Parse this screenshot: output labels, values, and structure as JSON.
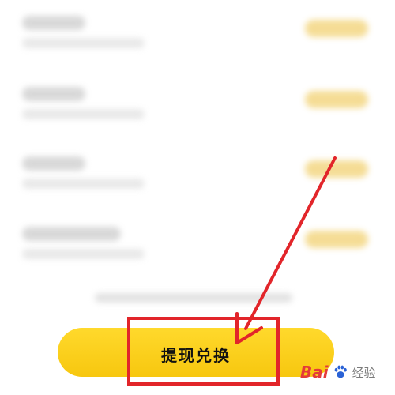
{
  "exchange_list": {
    "items": [
      {
        "title": "",
        "subtitle": "",
        "action": ""
      },
      {
        "title": "",
        "subtitle": "",
        "action": ""
      },
      {
        "title": "",
        "subtitle": "",
        "action": ""
      },
      {
        "title": "",
        "subtitle": "",
        "action": ""
      }
    ],
    "notice": ""
  },
  "cta": {
    "label": "提现兑换"
  },
  "annotation": {
    "highlight_color": "#e2252a",
    "arrow_color": "#e2252a"
  },
  "watermark": {
    "brand": "Bai",
    "paw_icon": "paw-icon",
    "suffix": "经验"
  },
  "colors": {
    "button": "#f7c70f",
    "placeholder_pill": "#f4d98a"
  }
}
